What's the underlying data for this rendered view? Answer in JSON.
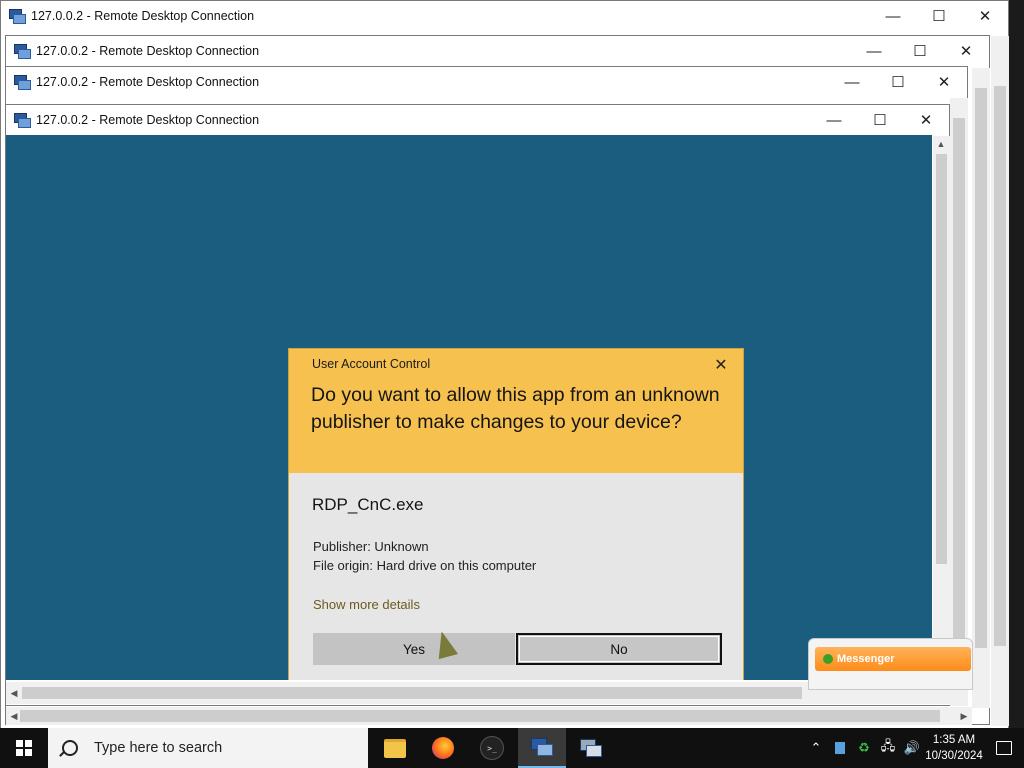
{
  "windows": [
    {
      "title": "127.0.0.2 - Remote Desktop Connection"
    },
    {
      "title": "127.0.0.2 - Remote Desktop Connection"
    },
    {
      "title": "127.0.0.2 - Remote Desktop Connection"
    },
    {
      "title": "127.0.0.2 - Remote Desktop Connection"
    }
  ],
  "window_controls": {
    "minimize": "—",
    "maximize": "☐",
    "close": "✕"
  },
  "uac": {
    "header": "User Account Control",
    "close": "✕",
    "question": "Do you want to allow this app from an unknown publisher to make changes to your device?",
    "app_name": "RDP_CnC.exe",
    "publisher": "Publisher: Unknown",
    "file_origin": "File origin: Hard drive on this computer",
    "more_details": "Show more details",
    "yes_label": "Yes",
    "no_label": "No"
  },
  "messenger": {
    "label": "Messenger"
  },
  "taskbar": {
    "search_placeholder": "Type here to search",
    "time": "1:35 AM",
    "date": "10/30/2024",
    "apps": [
      "file-explorer",
      "firefox",
      "terminal",
      "remote-desktop",
      "remote-desktop-2"
    ]
  },
  "colors": {
    "uac_header": "#f6c14e",
    "uac_body": "#e6e6e6",
    "remote_desktop_bg": "#1b5d7e",
    "taskbar": "#101010"
  }
}
